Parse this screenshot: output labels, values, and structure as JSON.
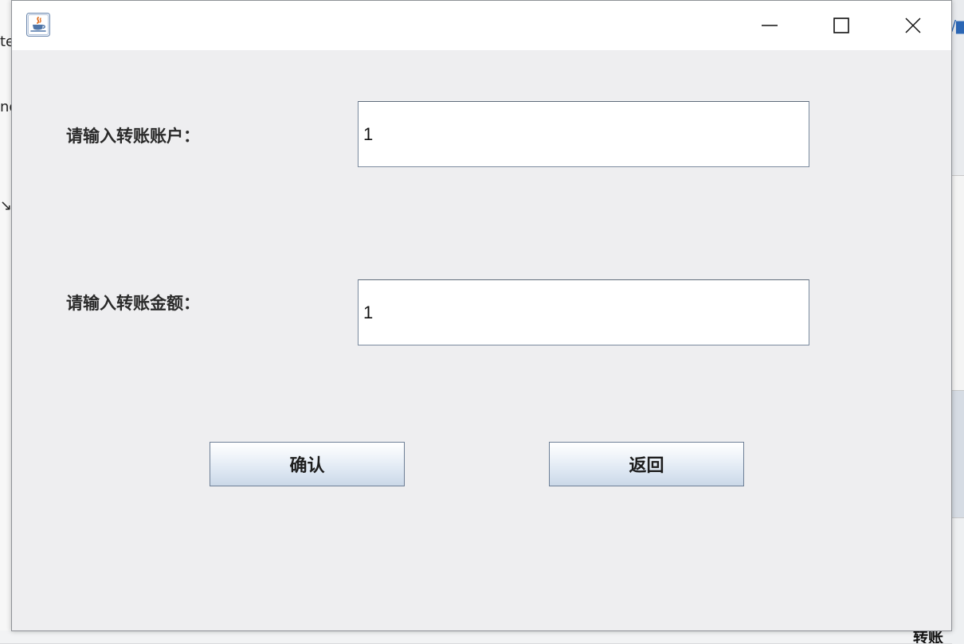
{
  "background": {
    "left_text_1": "te",
    "left_text_2": "nd",
    "left_text_3": "↘输",
    "bottom_right_text": "转账"
  },
  "window": {
    "title": "",
    "icon": "java-coffee-cup-icon",
    "controls": {
      "minimize": "minimize-icon",
      "maximize": "maximize-icon",
      "close": "close-icon"
    }
  },
  "form": {
    "account_label": "请输入转账账户：",
    "account_value": "1",
    "amount_label": "请输入转账金额：",
    "amount_value": "1"
  },
  "buttons": {
    "confirm_label": "确认",
    "back_label": "返回"
  },
  "colors": {
    "window_bg": "#eeeef0",
    "titlebar_bg": "#ffffff",
    "button_gradient_top": "#ffffff",
    "button_gradient_bottom": "#cbd8e8",
    "field_border": "#7a8a9e"
  }
}
